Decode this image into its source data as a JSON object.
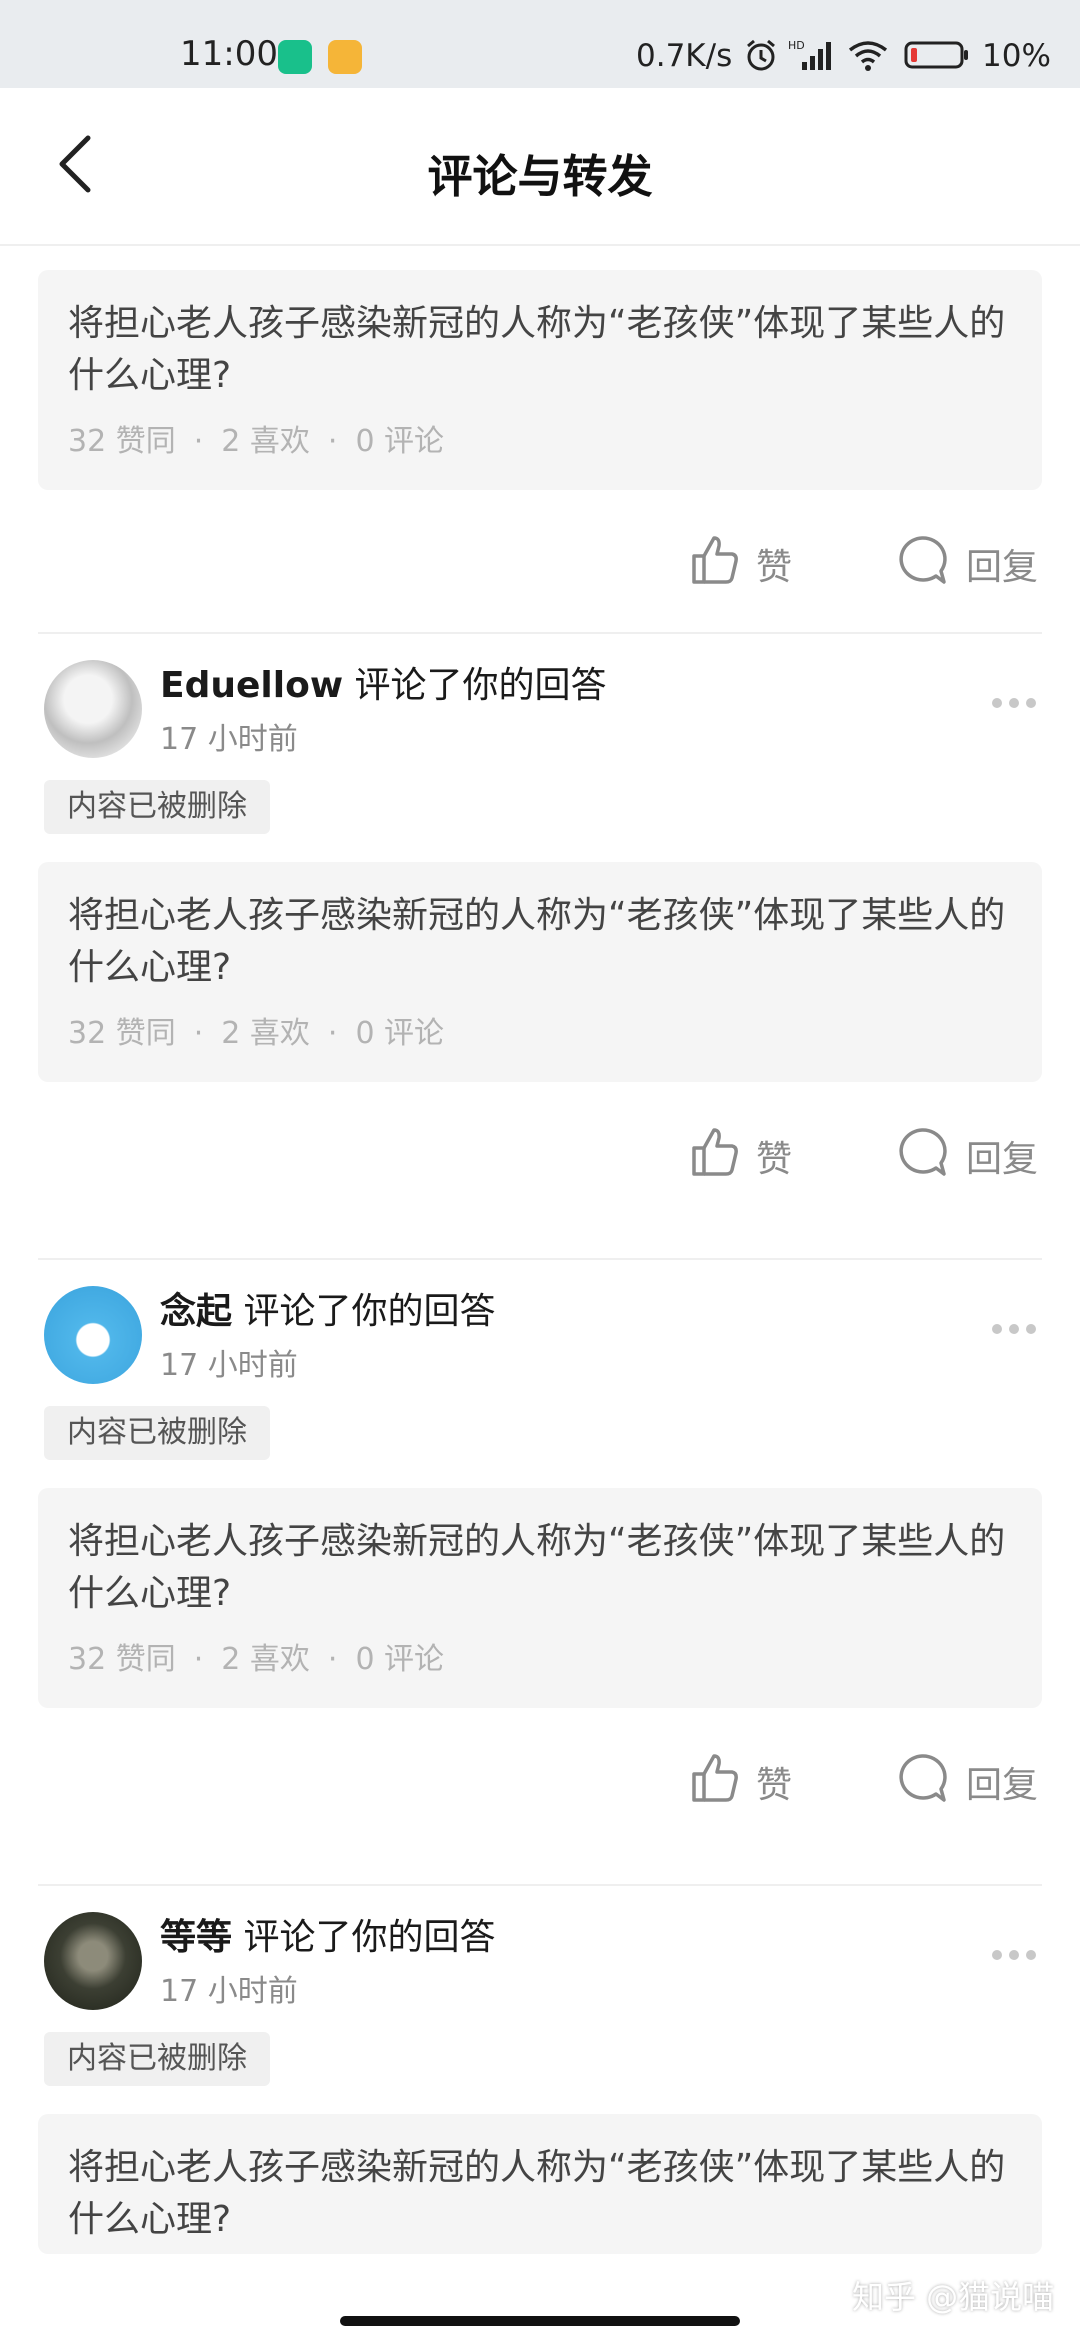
{
  "status_bar": {
    "time": "11:00",
    "net_speed": "0.7K/s",
    "battery": "10%",
    "app_icons": [
      "shield-app-icon",
      "notes-app-icon"
    ],
    "colors": {
      "app1": "#19c08b",
      "app2": "#f5b538",
      "battery_low": "#e53935"
    }
  },
  "header": {
    "title": "评论与转发",
    "back_icon": "chevron-left-icon"
  },
  "actions": {
    "like": "赞",
    "reply": "回复"
  },
  "items": [
    {
      "question": "将担心老人孩子感染新冠的人称为“老孩侠”体现了某些人的什么心理?",
      "meta": {
        "agree": "32 赞同",
        "likes": "2 喜欢",
        "comments": "0 评论"
      }
    },
    {
      "user": "Eduellow",
      "action_text": "评论了你的回答",
      "time": "17 小时前",
      "deleted_label": "内容已被删除",
      "question": "将担心老人孩子感染新冠的人称为“老孩侠”体现了某些人的什么心理?",
      "meta": {
        "agree": "32 赞同",
        "likes": "2 喜欢",
        "comments": "0 评论"
      }
    },
    {
      "user": "念起",
      "action_text": "评论了你的回答",
      "time": "17 小时前",
      "deleted_label": "内容已被删除",
      "question": "将担心老人孩子感染新冠的人称为“老孩侠”体现了某些人的什么心理?",
      "meta": {
        "agree": "32 赞同",
        "likes": "2 喜欢",
        "comments": "0 评论"
      }
    },
    {
      "user": "等等",
      "action_text": "评论了你的回答",
      "time": "17 小时前",
      "deleted_label": "内容已被删除",
      "question": "将担心老人孩子感染新冠的人称为“老孩侠”体现了某些人的什么心理?"
    }
  ],
  "separator": "·",
  "watermark": "知乎 @猫说喵"
}
